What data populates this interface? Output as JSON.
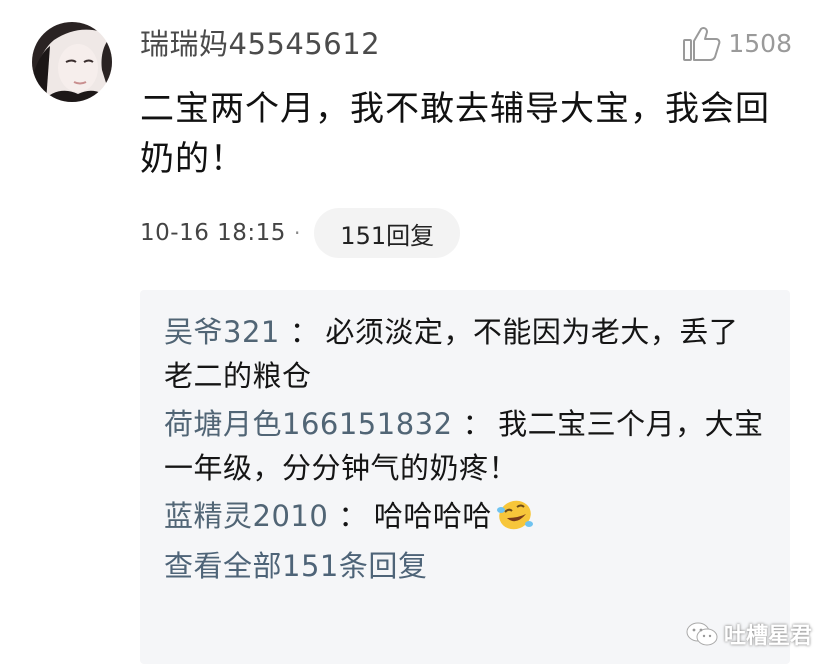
{
  "comment": {
    "username": "瑞瑞妈45545612",
    "like_count": "1508",
    "content": "二宝两个月，我不敢去辅导大宝，我会回奶的！",
    "timestamp": "10-16 18:15",
    "separator": "·",
    "reply_button": "151回复"
  },
  "replies": [
    {
      "name": "吴爷321",
      "separator": "：",
      "text": "必须淡定，不能因为老大，丢了老二的粮仓"
    },
    {
      "name": "荷塘月色166151832",
      "separator": "：",
      "text": "我二宝三个月，大宝一年级，分分钟气的奶疼！"
    },
    {
      "name": "蓝精灵2010",
      "separator": "：",
      "text": "哈哈哈哈",
      "emoji": "laughing-tears-emoji"
    }
  ],
  "view_all_replies": "查看全部151条回复",
  "watermark": {
    "text": "吐槽星君",
    "icon": "wechat-icon"
  },
  "icons": {
    "like": "thumbs-up-icon",
    "avatar": "user-avatar"
  },
  "colors": {
    "username": "#4b4b4b",
    "reply_name": "#516575",
    "link": "#4e6478",
    "reply_background": "#f5f6f8",
    "pill_background": "#f3f3f3"
  }
}
